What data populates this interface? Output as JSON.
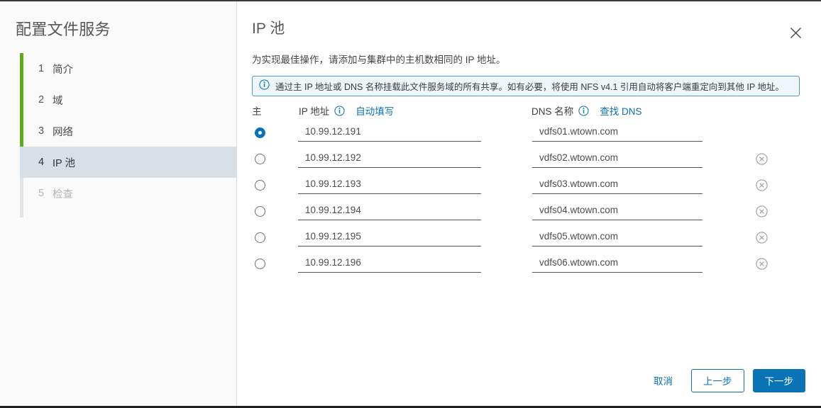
{
  "wizard": {
    "title": "配置文件服务",
    "steps": [
      {
        "num": "1",
        "label": "简介",
        "state": "done"
      },
      {
        "num": "2",
        "label": "域",
        "state": "done"
      },
      {
        "num": "3",
        "label": "网络",
        "state": "done"
      },
      {
        "num": "4",
        "label": "IP 池",
        "state": "active"
      },
      {
        "num": "5",
        "label": "检查",
        "state": "disabled"
      }
    ]
  },
  "panel": {
    "title": "IP 池",
    "close_icon": "close-icon",
    "subtitle": "为实现最佳操作，请添加与集群中的主机数相同的 IP 地址。",
    "info_banner": {
      "icon": "info-circle-icon",
      "text": "通过主 IP 地址或 DNS 名称挂载此文件服务域的所有共享。如有必要，将使用 NFS v4.1 引用自动将客户端重定向到其他 IP 地址。"
    }
  },
  "table": {
    "headers": {
      "primary": "主",
      "ip": "IP 地址",
      "ip_hint_icon": "info-circle-icon",
      "ip_action": "自动填写",
      "dns": "DNS 名称",
      "dns_hint_icon": "info-circle-icon",
      "dns_action": "查找 DNS"
    },
    "delete_icon": "remove-circle-icon",
    "rows": [
      {
        "primary": true,
        "ip": "10.99.12.191",
        "dns": "vdfs01.wtown.com",
        "deletable": false
      },
      {
        "primary": false,
        "ip": "10.99.12.192",
        "dns": "vdfs02.wtown.com",
        "deletable": true
      },
      {
        "primary": false,
        "ip": "10.99.12.193",
        "dns": "vdfs03.wtown.com",
        "deletable": true
      },
      {
        "primary": false,
        "ip": "10.99.12.194",
        "dns": "vdfs04.wtown.com",
        "deletable": true
      },
      {
        "primary": false,
        "ip": "10.99.12.195",
        "dns": "vdfs05.wtown.com",
        "deletable": true
      },
      {
        "primary": false,
        "ip": "10.99.12.196",
        "dns": "vdfs06.wtown.com",
        "deletable": true
      }
    ]
  },
  "footer": {
    "cancel": "取消",
    "back": "上一步",
    "next": "下一步"
  },
  "colors": {
    "accent_blue": "#0a73b6",
    "progress_green": "#60a917",
    "active_step_bg": "#d6e0e6",
    "banner_bg": "#eef7fb",
    "banner_border": "#4a9bd0"
  }
}
